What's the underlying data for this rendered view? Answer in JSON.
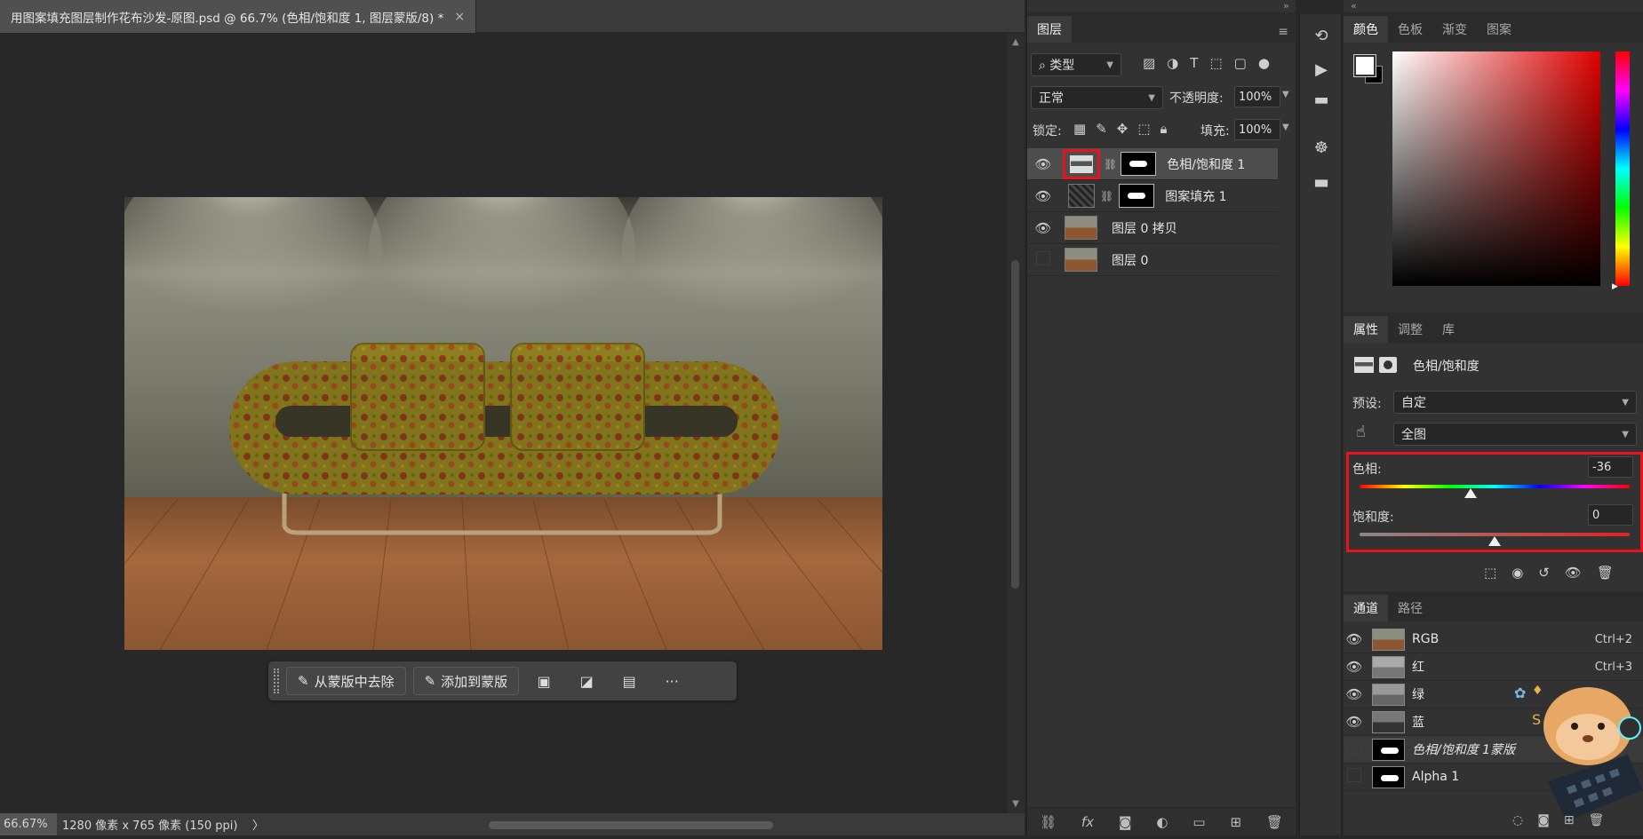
{
  "document": {
    "tab_title": "用图案填充图层制作花布沙发-原图.psd @ 66.7% (色相/饱和度 1, 图层蒙版/8) *",
    "close_glyph": "×"
  },
  "context_bar": {
    "remove_label": "从蒙版中去除",
    "add_label": "添加到蒙版",
    "more_label": "···"
  },
  "status": {
    "zoom": "66.67%",
    "doc_info": "1280 像素 x 765 像素 (150 ppi)",
    "arrow": "〉"
  },
  "layers_panel": {
    "tab": "图层",
    "filter_label": "类型",
    "blend_mode": "正常",
    "opacity_label": "不透明度:",
    "opacity_value": "100%",
    "lock_label": "锁定:",
    "fill_label": "填充:",
    "fill_value": "100%",
    "layers": [
      {
        "name": "色相/饱和度 1",
        "visible": true,
        "selected": true,
        "type": "adjustment"
      },
      {
        "name": "图案填充 1",
        "visible": true,
        "selected": false,
        "type": "pattern"
      },
      {
        "name": "图层 0 拷贝",
        "visible": true,
        "selected": false,
        "type": "image"
      },
      {
        "name": "图层 0",
        "visible": false,
        "selected": false,
        "type": "image"
      }
    ]
  },
  "color_panel": {
    "tabs": [
      "颜色",
      "色板",
      "渐变",
      "图案"
    ],
    "foreground": "#ffffff",
    "background": "#000000"
  },
  "properties_panel": {
    "tabs": [
      "属性",
      "调整",
      "库"
    ],
    "title": "色相/饱和度",
    "preset_label": "预设:",
    "preset_value": "自定",
    "range_value": "全图",
    "hue_label": "色相:",
    "hue_value": "-36",
    "hue_fraction": 0.41,
    "saturation_label": "饱和度:",
    "saturation_value": "0",
    "saturation_fraction": 0.5
  },
  "channels_panel": {
    "tabs": [
      "通道",
      "路径"
    ],
    "channels": [
      {
        "name": "RGB",
        "shortcut": "Ctrl+2",
        "visible": true,
        "thumb": "color"
      },
      {
        "name": "红",
        "shortcut": "Ctrl+3",
        "visible": true,
        "thumb": "gray"
      },
      {
        "name": "绿",
        "shortcut": "",
        "visible": true,
        "thumb": "gray"
      },
      {
        "name": "蓝",
        "shortcut": "",
        "visible": true,
        "thumb": "dark"
      },
      {
        "name": "色相/饱和度 1蒙版",
        "shortcut": "",
        "visible": false,
        "thumb": "mask"
      },
      {
        "name": "Alpha 1",
        "shortcut": "",
        "visible": false,
        "thumb": "mask"
      }
    ]
  },
  "colors": {
    "highlight_red": "#e8131e",
    "panel_bg": "#323232",
    "selected_row": "#4d4d4d"
  }
}
